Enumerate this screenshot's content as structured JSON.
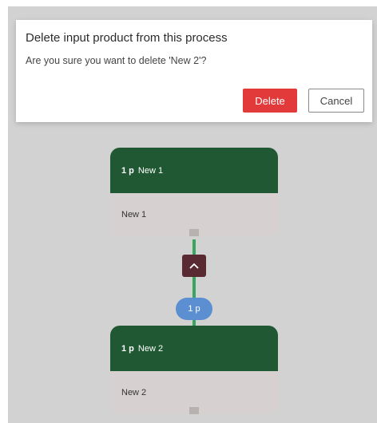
{
  "dialog": {
    "title": "Delete input product from this process",
    "message": "Are you sure you want to delete 'New 2'?",
    "delete_label": "Delete",
    "cancel_label": "Cancel"
  },
  "flow": {
    "nodes": [
      {
        "quantity": "1 p",
        "header_name": "New 1",
        "body_label": "New 1"
      },
      {
        "quantity": "1 p",
        "header_name": "New 2",
        "body_label": "New 2"
      }
    ],
    "link_quantity": "1 p",
    "collapse_icon": "chevron-up-icon"
  },
  "colors": {
    "node_header": "#1f5832",
    "connector": "#3aa55f",
    "collapse_button": "#5a2a33",
    "quantity_bubble": "#5b8fd1",
    "delete_button": "#e23a3a"
  }
}
